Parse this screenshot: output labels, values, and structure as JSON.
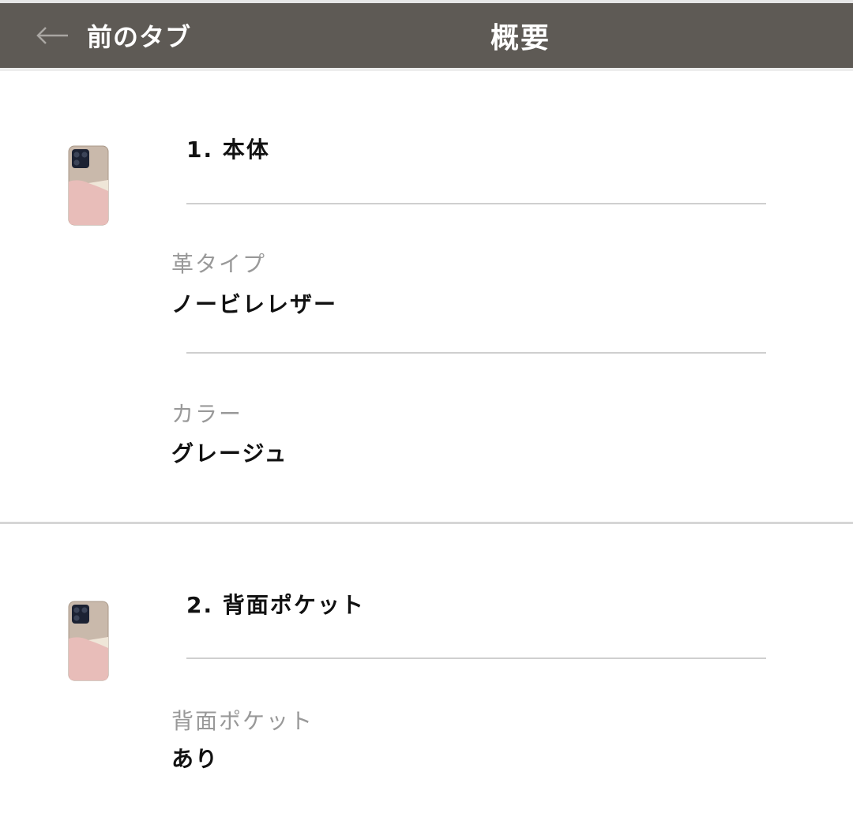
{
  "header": {
    "back_label": "前のタブ",
    "title": "概要"
  },
  "sections": [
    {
      "title": "1. 本体",
      "fields": [
        {
          "label": "革タイプ",
          "value": "ノービレレザー"
        },
        {
          "label": "カラー",
          "value": "グレージュ"
        }
      ]
    },
    {
      "title": "2. 背面ポケット",
      "fields": [
        {
          "label": "背面ポケット",
          "value": "あり"
        }
      ]
    }
  ],
  "colors": {
    "header_bg": "#5e5a55",
    "case_taupe": "#b5a598",
    "case_pink": "#e6b7b4",
    "case_cream": "#efe6d8",
    "camera": "#1c2233"
  },
  "icons": [
    "back-arrow-icon",
    "phone-case-thumbnail"
  ]
}
